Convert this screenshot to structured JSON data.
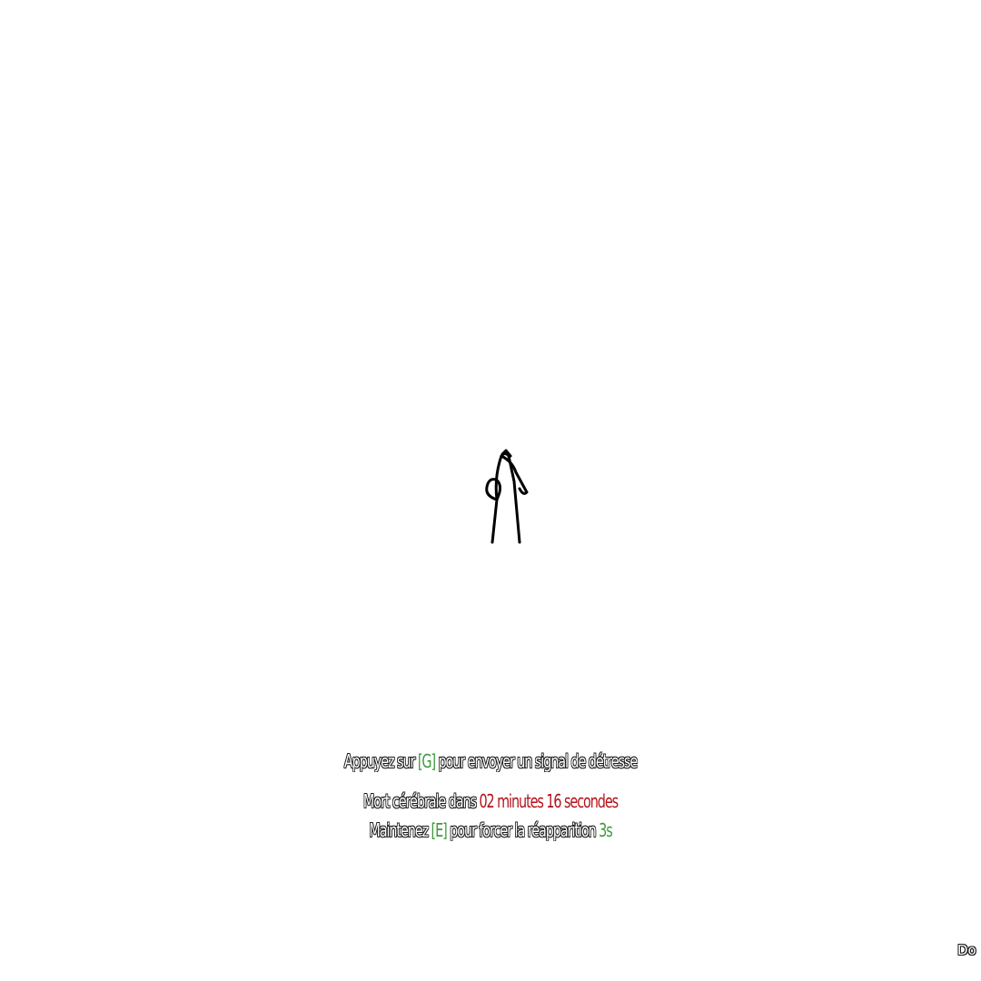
{
  "distress": {
    "prefix": "Appuyez sur",
    "key": "[G]",
    "suffix": "pour envoyer un signal de détresse"
  },
  "death_timer": {
    "prefix": "Mort cérébrale dans",
    "time": "02 minutes 16 secondes"
  },
  "respawn": {
    "prefix": "Maintenez",
    "key": "[E]",
    "middle": "pour forcer la réapparition",
    "seconds": "3s"
  },
  "corner_text": "Do",
  "colors": {
    "key_green": "#3c9a3c",
    "timer_red": "#b3131b",
    "outline": "#1a1a1a"
  },
  "icons": {
    "character": "downed-character-icon"
  }
}
